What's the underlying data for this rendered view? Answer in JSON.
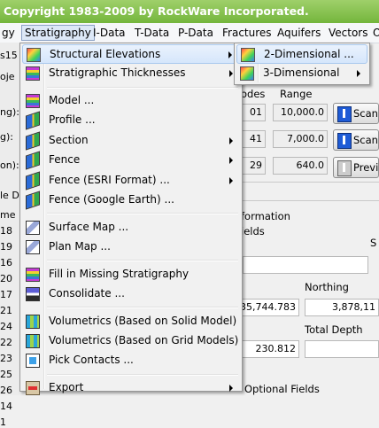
{
  "window": {
    "title": "Copyright 1983-2009 by RockWare Incorporated."
  },
  "menubar": {
    "items": [
      {
        "label": "gy"
      },
      {
        "label": "Stratigraphy"
      },
      {
        "label": "I-Data"
      },
      {
        "label": "T-Data"
      },
      {
        "label": "P-Data"
      },
      {
        "label": "Fractures"
      },
      {
        "label": "Aquifers"
      },
      {
        "label": "Vectors"
      },
      {
        "label": "O"
      }
    ]
  },
  "background": {
    "left_labels": [
      "s15",
      "oje",
      "ng):",
      "g):",
      "on):",
      "le D",
      "me",
      "18",
      "19",
      "16",
      "20",
      "17",
      "21",
      "24",
      "22",
      "23",
      "25",
      "26",
      "14",
      "1"
    ],
    "col_nodes": "odes",
    "col_range": "Range",
    "nodes": [
      "01",
      "41",
      "29"
    ],
    "ranges": [
      "10,000.0",
      "7,000.0",
      "640.0"
    ],
    "scan_label": "Scan",
    "preview_label": "Previ",
    "information_label": "formation",
    "fields_label": "ields",
    "s_label": "S",
    "northing_label": "Northing",
    "easting_value": "35,744.783",
    "northing_value": "3,878,11",
    "total_depth_label": "Total Depth",
    "elev_value": "230.812",
    "optional_fields_label": "Optional Fields"
  },
  "menu": {
    "items": [
      {
        "label": "Structural Elevations",
        "icon": "structural-elevations-icon",
        "submenu": true,
        "highlighted": true
      },
      {
        "label": "Stratigraphic Thicknesses",
        "icon": "thickness-icon",
        "submenu": true
      },
      {
        "sep": true
      },
      {
        "label": "Model ...",
        "icon": "model-icon"
      },
      {
        "label": "Profile ...",
        "icon": "profile-icon"
      },
      {
        "label": "Section",
        "icon": "section-icon",
        "submenu": true
      },
      {
        "label": "Fence",
        "icon": "fence-icon",
        "submenu": true
      },
      {
        "label": "Fence (ESRI Format) ...",
        "icon": "fence-esri-icon",
        "submenu": true
      },
      {
        "label": "Fence (Google Earth) ...",
        "icon": "fence-google-icon"
      },
      {
        "sep": true
      },
      {
        "label": "Surface Map ...",
        "icon": "surface-map-icon"
      },
      {
        "label": "Plan Map ...",
        "icon": "plan-map-icon"
      },
      {
        "sep": true
      },
      {
        "label": "Fill in Missing Stratigraphy",
        "icon": "fill-missing-icon"
      },
      {
        "label": "Consolidate ...",
        "icon": "consolidate-icon"
      },
      {
        "sep": true
      },
      {
        "label": "Volumetrics (Based on Solid Model)",
        "icon": "volumetrics-solid-icon"
      },
      {
        "label": "Volumetrics (Based on Grid Models)",
        "icon": "volumetrics-grid-icon"
      },
      {
        "label": "Pick Contacts ...",
        "icon": "pick-contacts-icon"
      },
      {
        "sep": true
      },
      {
        "label": "Export",
        "icon": "export-icon",
        "submenu": true
      }
    ]
  },
  "submenu": {
    "items": [
      {
        "label": "2-Dimensional ...",
        "icon": "two-d-map-icon",
        "highlighted": true
      },
      {
        "label": "3-Dimensional",
        "icon": "three-d-map-icon",
        "submenu": true
      }
    ]
  }
}
